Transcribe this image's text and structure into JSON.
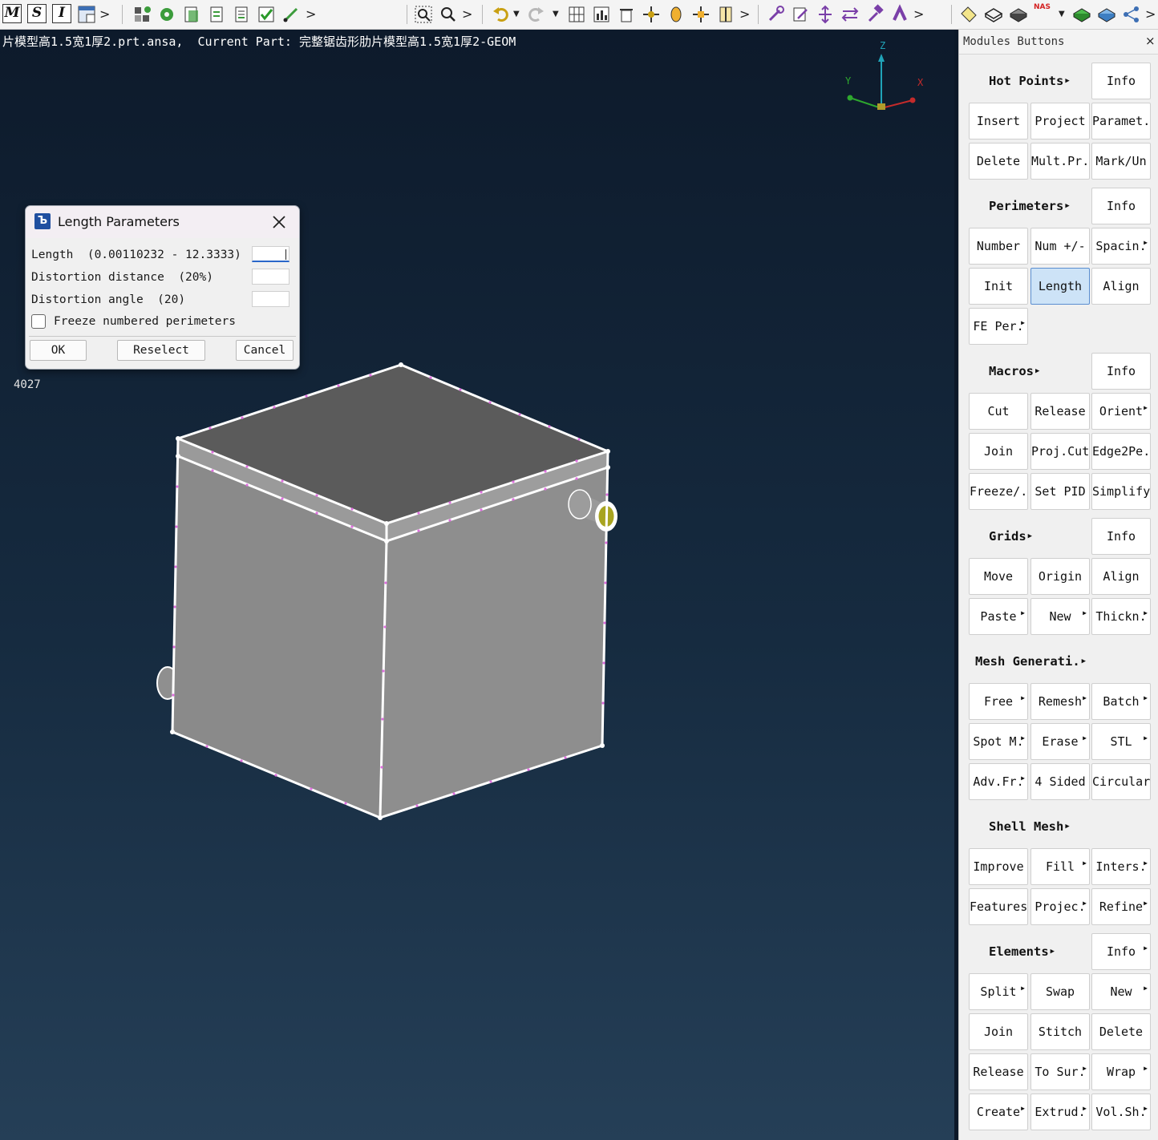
{
  "toolbar": {
    "mode_buttons": [
      {
        "label": "M",
        "name": "m-mode-button"
      },
      {
        "label": "S",
        "name": "s-mode-button"
      },
      {
        "label": "I",
        "name": "i-mode-button"
      }
    ],
    "nas_badge": "NAS",
    "icons": [
      "window-layout-icon",
      "hierarchy-icon",
      "gear-settings-icon",
      "properties-icon",
      "checklist-icon",
      "report-icon",
      "check-icon",
      "paint-brush-icon",
      "zoom-window-icon",
      "zoom-icon",
      "undo-icon",
      "redo-icon",
      "grid-view-icon",
      "data-chart-icon",
      "trash-icon",
      "move-icon",
      "orient-icon",
      "translate-icon",
      "section-icon",
      "wrench-icon",
      "edit-note-icon",
      "spread-icon",
      "transfer-icon",
      "hammer-icon",
      "magnet-icon",
      "tag-icon",
      "wire-box-icon",
      "shaded-box-icon",
      "green-box-icon",
      "blue-box-icon",
      "tree-icon"
    ],
    "accent_color": "#2a67c9"
  },
  "viewport": {
    "title": "片模型高1.5宽1厚2.prt.ansa,  Current Part: 完整锯齿形肋片模型高1.5宽1厚2-GEOM",
    "entity_id": "4027",
    "axes": {
      "x": "X",
      "y": "Y",
      "z": "Z"
    },
    "colors": {
      "background_top": "#0d1a2b",
      "background_bottom": "#253f57",
      "model_face": "#8c8c8c",
      "model_top": "#5a5a5a",
      "edge": "#ffffff",
      "perimeter_nodes": "#e070e0",
      "pipe_end": "#a8a420"
    }
  },
  "dialog": {
    "title": "Length Parameters",
    "rows": [
      {
        "label": "Length  (0.00110232 - 12.3333)",
        "value": ""
      },
      {
        "label": "Distortion distance  (20%)",
        "value": ""
      },
      {
        "label": "Distortion angle  (20)",
        "value": ""
      }
    ],
    "checkbox_label": "Freeze numbered perimeters",
    "checkbox_checked": false,
    "buttons": {
      "ok": "OK",
      "reselect": "Reselect",
      "cancel": "Cancel"
    }
  },
  "panel": {
    "title": "Modules Buttons",
    "close": "×",
    "sections": [
      {
        "title": "Hot Points",
        "info": "Info",
        "rows": [
          [
            "Insert",
            "Project",
            "Paramet."
          ],
          [
            "Delete",
            "Mult.Pr.",
            "Mark/Un"
          ]
        ]
      },
      {
        "title": "Perimeters",
        "info": "Info",
        "rows": [
          [
            "Number",
            "Num +/-",
            "Spacin."
          ],
          [
            "Init",
            "Length",
            "Align"
          ],
          [
            "FE Per."
          ]
        ]
      },
      {
        "title": "Macros",
        "info": "Info",
        "rows": [
          [
            "Cut",
            "Release",
            "Orient"
          ],
          [
            "Join",
            "Proj.Cut",
            "Edge2Pe."
          ],
          [
            "Freeze/.",
            "Set PID",
            "Simplify"
          ]
        ]
      },
      {
        "title": "Grids",
        "info": "Info",
        "rows": [
          [
            "Move",
            "Origin",
            "Align"
          ],
          [
            "Paste",
            "New",
            "Thickn."
          ]
        ]
      },
      {
        "title": "Mesh Generati.",
        "info": "",
        "rows": [
          [
            "Free",
            "Remesh",
            "Batch"
          ],
          [
            "Spot M.",
            "Erase",
            "STL"
          ],
          [
            "Adv.Fr.",
            "4 Sided",
            "Circular"
          ]
        ]
      },
      {
        "title": "Shell Mesh",
        "info": "",
        "rows": [
          [
            "Improve",
            "Fill",
            "Inters."
          ],
          [
            "Features",
            "Projec.",
            "Refine"
          ]
        ]
      },
      {
        "title": "Elements",
        "info": "Info",
        "rows": [
          [
            "Split",
            "Swap",
            "New"
          ],
          [
            "Join",
            "Stitch",
            "Delete"
          ],
          [
            "Release",
            "To Sur.",
            "Wrap"
          ],
          [
            "Create",
            "Extrud.",
            "Vol.Sh."
          ]
        ]
      }
    ],
    "active_button": "Length"
  }
}
